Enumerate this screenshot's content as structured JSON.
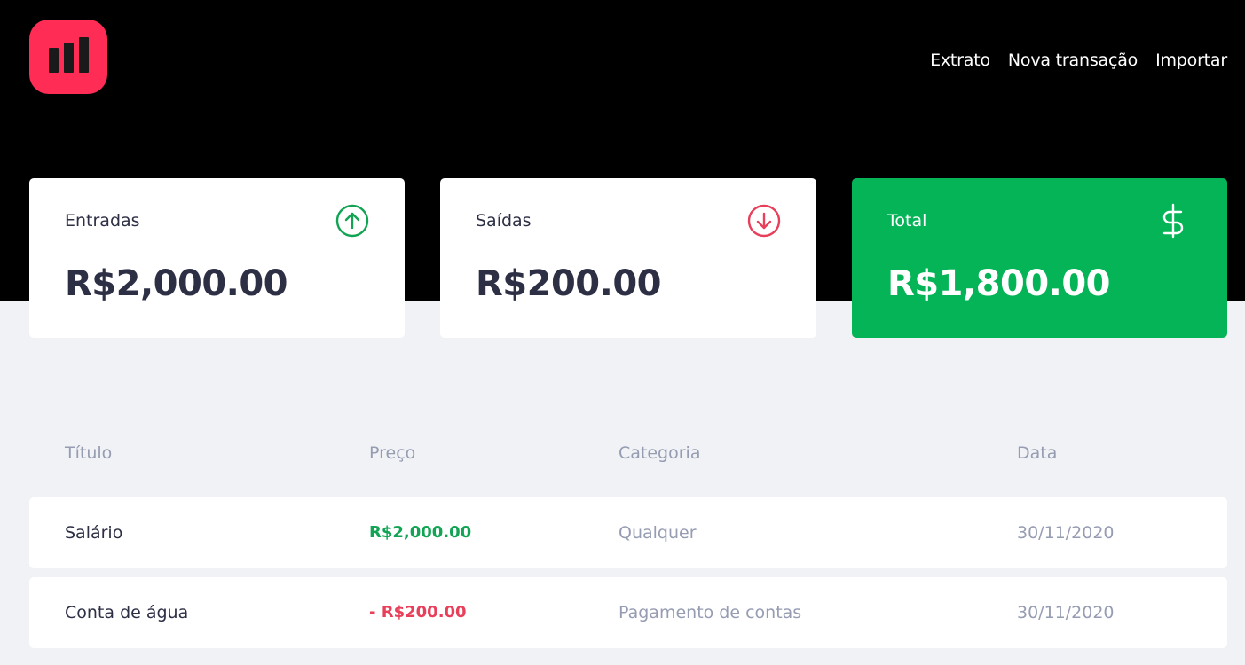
{
  "nav": {
    "links": [
      "Extrato",
      "Nova transação",
      "Importar"
    ]
  },
  "cards": {
    "income": {
      "label": "Entradas",
      "value": "R$2,000.00",
      "icon": "arrow-up-circle-icon"
    },
    "outcome": {
      "label": "Saídas",
      "value": "R$200.00",
      "icon": "arrow-down-circle-icon"
    },
    "total": {
      "label": "Total",
      "value": "R$1,800.00",
      "icon": "dollar-sign-icon"
    }
  },
  "table": {
    "headers": [
      "Título",
      "Preço",
      "Categoria",
      "Data"
    ],
    "rows": [
      {
        "title": "Salário",
        "price": "R$2,000.00",
        "type": "income",
        "category": "Qualquer",
        "date": "30/11/2020"
      },
      {
        "title": "Conta de água",
        "price": "- R$200.00",
        "type": "outcome",
        "category": "Pagamento de contas",
        "date": "30/11/2020"
      }
    ]
  },
  "colors": {
    "header_bg": "#000000",
    "page_bg": "#F0F2F5",
    "logo": "#FF2D55",
    "income": "#12A454",
    "outcome": "#E83F5B",
    "total_card": "#04B457",
    "text_title": "#2D2F45",
    "text_muted": "#969CB2"
  }
}
